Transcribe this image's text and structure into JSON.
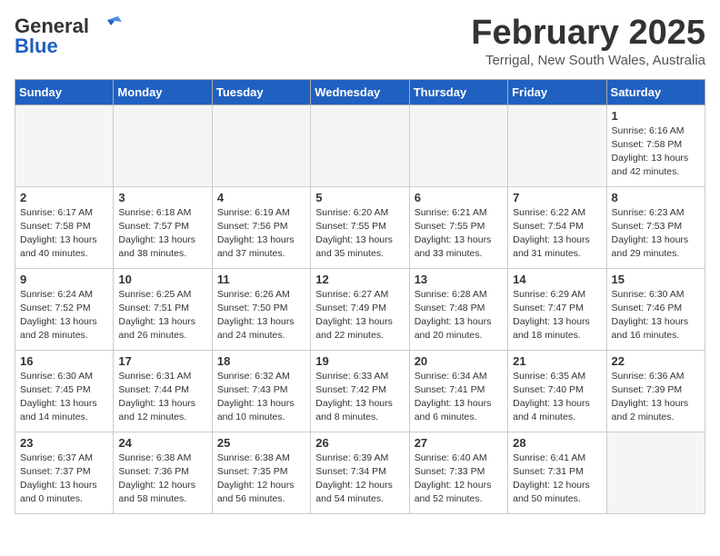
{
  "header": {
    "logo_general": "General",
    "logo_blue": "Blue",
    "month_title": "February 2025",
    "location": "Terrigal, New South Wales, Australia"
  },
  "weekdays": [
    "Sunday",
    "Monday",
    "Tuesday",
    "Wednesday",
    "Thursday",
    "Friday",
    "Saturday"
  ],
  "weeks": [
    [
      {
        "day": "",
        "info": ""
      },
      {
        "day": "",
        "info": ""
      },
      {
        "day": "",
        "info": ""
      },
      {
        "day": "",
        "info": ""
      },
      {
        "day": "",
        "info": ""
      },
      {
        "day": "",
        "info": ""
      },
      {
        "day": "1",
        "info": "Sunrise: 6:16 AM\nSunset: 7:58 PM\nDaylight: 13 hours\nand 42 minutes."
      }
    ],
    [
      {
        "day": "2",
        "info": "Sunrise: 6:17 AM\nSunset: 7:58 PM\nDaylight: 13 hours\nand 40 minutes."
      },
      {
        "day": "3",
        "info": "Sunrise: 6:18 AM\nSunset: 7:57 PM\nDaylight: 13 hours\nand 38 minutes."
      },
      {
        "day": "4",
        "info": "Sunrise: 6:19 AM\nSunset: 7:56 PM\nDaylight: 13 hours\nand 37 minutes."
      },
      {
        "day": "5",
        "info": "Sunrise: 6:20 AM\nSunset: 7:55 PM\nDaylight: 13 hours\nand 35 minutes."
      },
      {
        "day": "6",
        "info": "Sunrise: 6:21 AM\nSunset: 7:55 PM\nDaylight: 13 hours\nand 33 minutes."
      },
      {
        "day": "7",
        "info": "Sunrise: 6:22 AM\nSunset: 7:54 PM\nDaylight: 13 hours\nand 31 minutes."
      },
      {
        "day": "8",
        "info": "Sunrise: 6:23 AM\nSunset: 7:53 PM\nDaylight: 13 hours\nand 29 minutes."
      }
    ],
    [
      {
        "day": "9",
        "info": "Sunrise: 6:24 AM\nSunset: 7:52 PM\nDaylight: 13 hours\nand 28 minutes."
      },
      {
        "day": "10",
        "info": "Sunrise: 6:25 AM\nSunset: 7:51 PM\nDaylight: 13 hours\nand 26 minutes."
      },
      {
        "day": "11",
        "info": "Sunrise: 6:26 AM\nSunset: 7:50 PM\nDaylight: 13 hours\nand 24 minutes."
      },
      {
        "day": "12",
        "info": "Sunrise: 6:27 AM\nSunset: 7:49 PM\nDaylight: 13 hours\nand 22 minutes."
      },
      {
        "day": "13",
        "info": "Sunrise: 6:28 AM\nSunset: 7:48 PM\nDaylight: 13 hours\nand 20 minutes."
      },
      {
        "day": "14",
        "info": "Sunrise: 6:29 AM\nSunset: 7:47 PM\nDaylight: 13 hours\nand 18 minutes."
      },
      {
        "day": "15",
        "info": "Sunrise: 6:30 AM\nSunset: 7:46 PM\nDaylight: 13 hours\nand 16 minutes."
      }
    ],
    [
      {
        "day": "16",
        "info": "Sunrise: 6:30 AM\nSunset: 7:45 PM\nDaylight: 13 hours\nand 14 minutes."
      },
      {
        "day": "17",
        "info": "Sunrise: 6:31 AM\nSunset: 7:44 PM\nDaylight: 13 hours\nand 12 minutes."
      },
      {
        "day": "18",
        "info": "Sunrise: 6:32 AM\nSunset: 7:43 PM\nDaylight: 13 hours\nand 10 minutes."
      },
      {
        "day": "19",
        "info": "Sunrise: 6:33 AM\nSunset: 7:42 PM\nDaylight: 13 hours\nand 8 minutes."
      },
      {
        "day": "20",
        "info": "Sunrise: 6:34 AM\nSunset: 7:41 PM\nDaylight: 13 hours\nand 6 minutes."
      },
      {
        "day": "21",
        "info": "Sunrise: 6:35 AM\nSunset: 7:40 PM\nDaylight: 13 hours\nand 4 minutes."
      },
      {
        "day": "22",
        "info": "Sunrise: 6:36 AM\nSunset: 7:39 PM\nDaylight: 13 hours\nand 2 minutes."
      }
    ],
    [
      {
        "day": "23",
        "info": "Sunrise: 6:37 AM\nSunset: 7:37 PM\nDaylight: 13 hours\nand 0 minutes."
      },
      {
        "day": "24",
        "info": "Sunrise: 6:38 AM\nSunset: 7:36 PM\nDaylight: 12 hours\nand 58 minutes."
      },
      {
        "day": "25",
        "info": "Sunrise: 6:38 AM\nSunset: 7:35 PM\nDaylight: 12 hours\nand 56 minutes."
      },
      {
        "day": "26",
        "info": "Sunrise: 6:39 AM\nSunset: 7:34 PM\nDaylight: 12 hours\nand 54 minutes."
      },
      {
        "day": "27",
        "info": "Sunrise: 6:40 AM\nSunset: 7:33 PM\nDaylight: 12 hours\nand 52 minutes."
      },
      {
        "day": "28",
        "info": "Sunrise: 6:41 AM\nSunset: 7:31 PM\nDaylight: 12 hours\nand 50 minutes."
      },
      {
        "day": "",
        "info": ""
      }
    ]
  ]
}
